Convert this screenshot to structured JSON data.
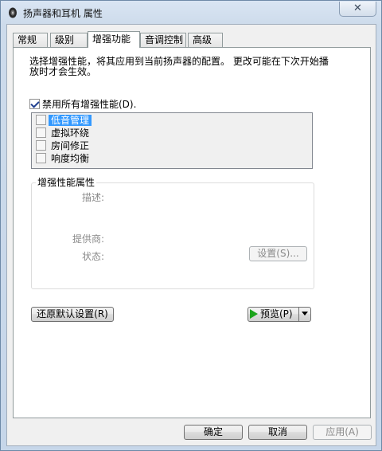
{
  "window": {
    "title": "扬声器和耳机 属性",
    "close_label": "✕"
  },
  "tabs": [
    {
      "label": "常规"
    },
    {
      "label": "级别"
    },
    {
      "label": "增强功能",
      "active": true
    },
    {
      "label": "音调控制"
    },
    {
      "label": "高级"
    }
  ],
  "enhancements": {
    "description": "选择增强性能，将其应用到当前扬声器的配置。  更改可能在下次开始播放时才会生效。",
    "disable_all": {
      "label": "禁用所有增强性能(D).",
      "checked": true
    },
    "items": [
      {
        "label": "低音管理",
        "checked": false,
        "selected": true
      },
      {
        "label": "虚拟环绕",
        "checked": false,
        "selected": false
      },
      {
        "label": "房间修正",
        "checked": false,
        "selected": false
      },
      {
        "label": "响度均衡",
        "checked": false,
        "selected": false
      }
    ]
  },
  "properties": {
    "group_title": "增强性能属性",
    "description_label": "描述:",
    "provider_label": "提供商:",
    "status_label": "状态:",
    "settings_button": "设置(S)..."
  },
  "actions": {
    "restore_defaults": "还原默认设置(R)",
    "preview": "预览(P)"
  },
  "footer": {
    "ok": "确定",
    "cancel": "取消",
    "apply": "应用(A)"
  }
}
